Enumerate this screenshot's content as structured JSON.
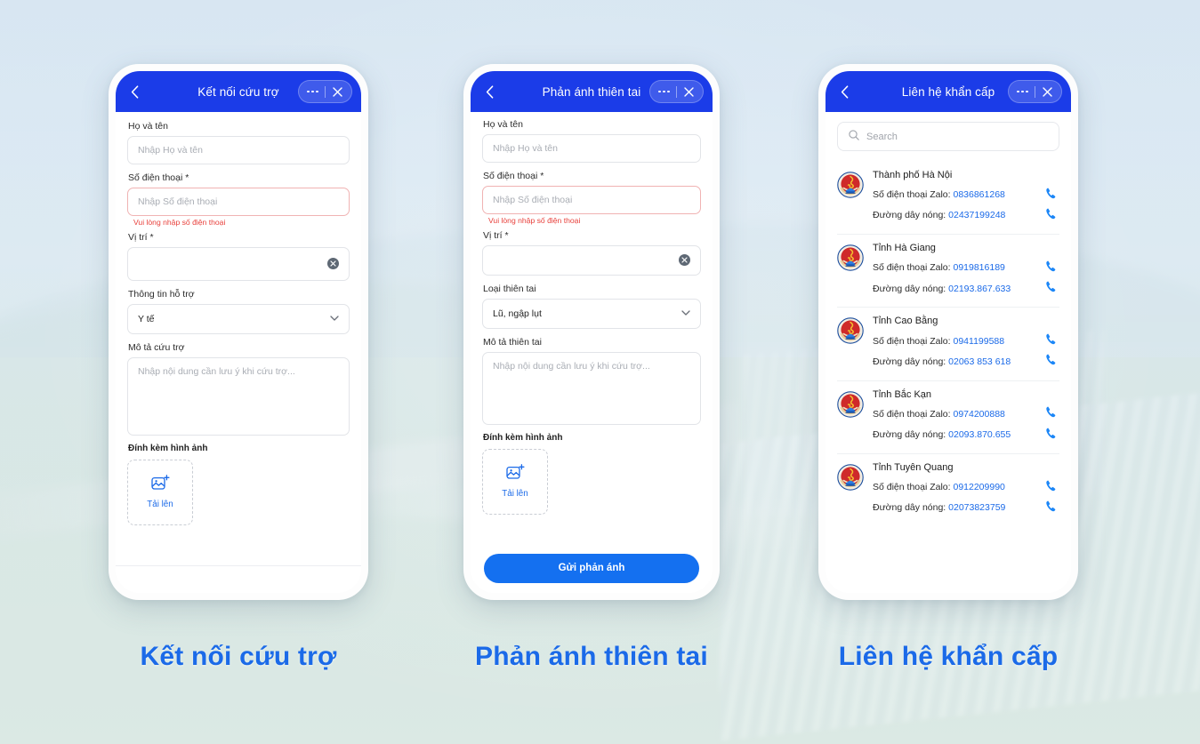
{
  "captions": {
    "one": "Kết nối cứu trợ",
    "two": "Phản ánh thiên tai",
    "three": "Liên hệ khẩn cấp"
  },
  "screen1": {
    "header": {
      "title": "Kết nối cứu trợ",
      "back_icon": "chevron-left-icon",
      "more_icon": "more-dots-icon",
      "close_icon": "close-icon"
    },
    "fields": {
      "name_label": "Họ và tên",
      "name_placeholder": "Nhập Họ và tên",
      "phone_label": "Số điện thoại *",
      "phone_placeholder": "Nhập Số điện thoại",
      "phone_error": "Vui lòng nhập số điện thoại",
      "location_label": "Vị trí *",
      "location_value": "",
      "support_label": "Thông tin hỗ trợ",
      "support_value": "Y tế",
      "desc_label": "Mô tả cứu trợ",
      "desc_placeholder": "Nhập nội dung cần lưu ý khi cứu trợ..."
    },
    "attach_label": "Đính kèm hình ảnh",
    "upload_label": "Tải lên"
  },
  "screen2": {
    "header": {
      "title": "Phản ánh thiên tai",
      "back_icon": "chevron-left-icon",
      "more_icon": "more-dots-icon",
      "close_icon": "close-icon"
    },
    "fields": {
      "name_label": "Họ và tên",
      "name_placeholder": "Nhập Họ và tên",
      "phone_label": "Số điện thoại *",
      "phone_placeholder": "Nhập Số điện thoại",
      "phone_error": "Vui lòng nhập số điện thoại",
      "location_label": "Vị trí *",
      "location_value": "",
      "type_label": "Loại thiên tai",
      "type_value": "Lũ, ngập lụt",
      "desc_label": "Mô tả thiên tai",
      "desc_placeholder": "Nhập nội dung cần lưu ý khi cứu trợ..."
    },
    "attach_label": "Đính kèm hình ảnh",
    "upload_label": "Tải lên",
    "submit_label": "Gửi phản ánh"
  },
  "screen3": {
    "header": {
      "title": "Liên hệ khẩn cấp",
      "back_icon": "chevron-left-icon",
      "more_icon": "more-dots-icon",
      "close_icon": "close-icon"
    },
    "search_placeholder": "Search",
    "zalo_label": "Số điện thoại Zalo:",
    "hotline_label": "Đường dây nóng:",
    "contacts": [
      {
        "name": "Thành phố Hà Nội",
        "zalo": "0836861268",
        "hotline": "02437199248"
      },
      {
        "name": "Tỉnh Hà Giang",
        "zalo": "0919816189",
        "hotline": "02193.867.633"
      },
      {
        "name": "Tỉnh Cao Bằng",
        "zalo": "0941199588",
        "hotline": "02063 853 618"
      },
      {
        "name": "Tỉnh Bắc Kạn",
        "zalo": "0974200888",
        "hotline": "02093.870.655"
      },
      {
        "name": "Tỉnh Tuyên Quang",
        "zalo": "0912209990",
        "hotline": "02073823759"
      }
    ]
  },
  "colors": {
    "header_blue": "#1b3ce8",
    "accent_blue": "#1b6ae8",
    "button_blue": "#1470f0",
    "error_red": "#e8413c"
  }
}
